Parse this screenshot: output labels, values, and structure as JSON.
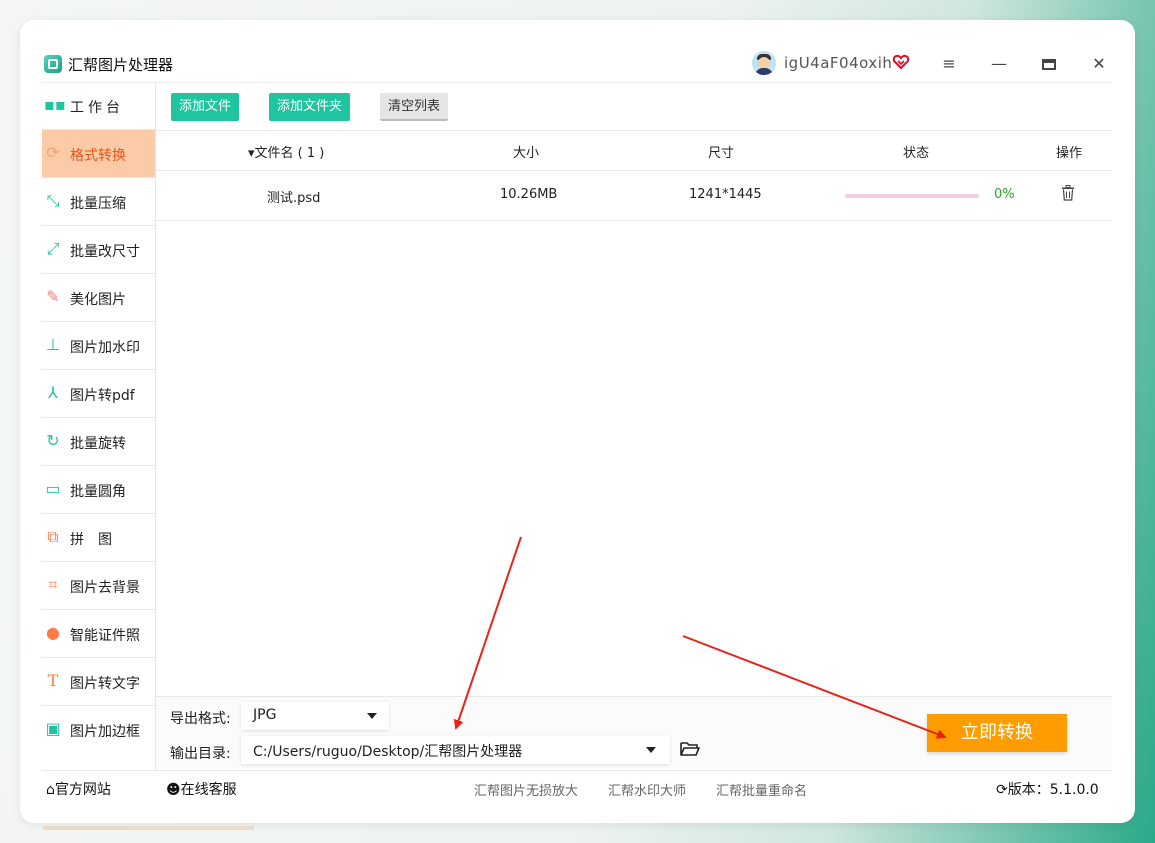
{
  "app": {
    "title": "汇帮图片处理器",
    "username": "igU4aF04oxih"
  },
  "titlebar": {
    "menu_icon": "menu-icon",
    "minimize_icon": "minimize-icon",
    "maximize_icon": "maximize-icon",
    "close_icon": "close-icon",
    "vip_icon": "vip-heart-icon"
  },
  "sidebar": {
    "items": [
      {
        "label": "工作台",
        "icon": "workspace-grid-icon",
        "color": "#20c5a0"
      },
      {
        "label": "格式转换",
        "icon": "format-convert-icon",
        "color": "#e8541b",
        "active": true
      },
      {
        "label": "批量压缩",
        "icon": "compress-icon",
        "color": "#20c5a0"
      },
      {
        "label": "批量改尺寸",
        "icon": "resize-icon",
        "color": "#20c5a0"
      },
      {
        "label": "美化图片",
        "icon": "beautify-icon",
        "color": "#f08080"
      },
      {
        "label": "图片加水印",
        "icon": "watermark-icon",
        "color": "#20c5a0"
      },
      {
        "label": "图片转pdf",
        "icon": "pdf-icon",
        "color": "#20c5a0"
      },
      {
        "label": "批量旋转",
        "icon": "rotate-icon",
        "color": "#20c5a0"
      },
      {
        "label": "批量圆角",
        "icon": "round-corner-icon",
        "color": "#20c5a0"
      },
      {
        "label": "拼　图",
        "icon": "puzzle-icon",
        "color": "#ff7a45"
      },
      {
        "label": "图片去背景",
        "icon": "crop-icon",
        "color": "#ff7a45"
      },
      {
        "label": "智能证件照",
        "icon": "id-photo-icon",
        "color": "#ff7a45"
      },
      {
        "label": "图片转文字",
        "icon": "text-icon",
        "color": "#ff7a45"
      },
      {
        "label": "图片加边框",
        "icon": "frame-icon",
        "color": "#20c5a0"
      }
    ]
  },
  "toolbar": {
    "add_file": "添加文件",
    "add_folder": "添加文件夹",
    "clear_list": "清空列表"
  },
  "table": {
    "headers": {
      "name": "▾文件名 ( 1 )",
      "size": "大小",
      "dimension": "尺寸",
      "status": "状态",
      "action": "操作"
    },
    "rows": [
      {
        "name": "测试.psd",
        "size": "10.26MB",
        "dimension": "1241*1445",
        "progress": 0,
        "progress_text": "0%"
      }
    ]
  },
  "settings": {
    "format_label": "导出格式:",
    "format_value": "JPG",
    "dir_label": "输出目录:",
    "dir_value": "C:/Users/ruguo/Desktop/汇帮图片处理器"
  },
  "convert_button": "立即转换",
  "footer": {
    "website": "官方网站",
    "support": "在线客服",
    "links": [
      "汇帮图片无损放大",
      "汇帮水印大师",
      "汇帮批量重命名"
    ],
    "version_label": "版本：",
    "version": "5.1.0.0"
  },
  "colors": {
    "accent_green": "#20c5a0",
    "active_orange": "#e8541b",
    "convert_orange": "#ff9d00",
    "annotation_red": "#e8231c"
  }
}
